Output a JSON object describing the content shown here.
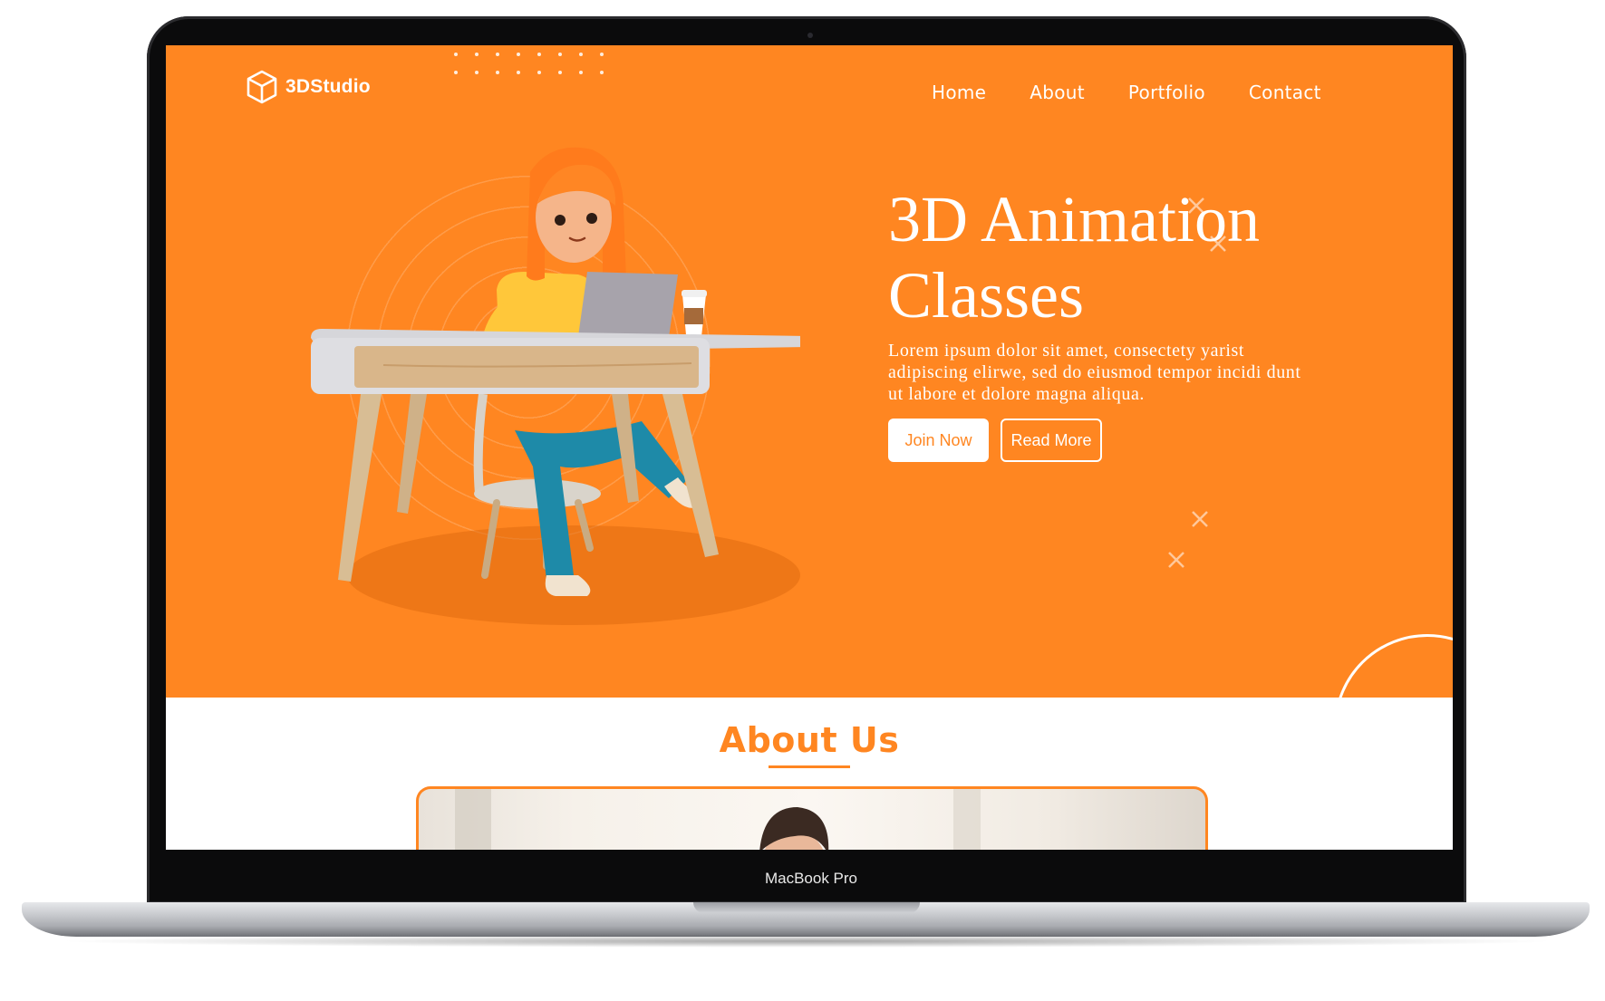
{
  "device": {
    "label": "MacBook Pro"
  },
  "site": {
    "brand": {
      "name": "3DStudio",
      "icon": "cube-icon"
    },
    "nav": {
      "items": [
        {
          "label": "Home"
        },
        {
          "label": "About"
        },
        {
          "label": "Portfolio"
        },
        {
          "label": "Contact"
        }
      ]
    },
    "hero": {
      "title_line1": "3D Animation",
      "title_line2": "Classes",
      "text": "Lorem ipsum dolor sit amet, consectety yarist adipiscing elirwe, sed do eiusmod tempor incidi dunt ut labore et dolore magna aliqua.",
      "join_label": "Join Now",
      "read_more_label": "Read More"
    },
    "about": {
      "title": "About Us"
    }
  },
  "colors": {
    "accent": "#ff8621",
    "white": "#ffffff",
    "bezel": "#0b0b0c"
  }
}
